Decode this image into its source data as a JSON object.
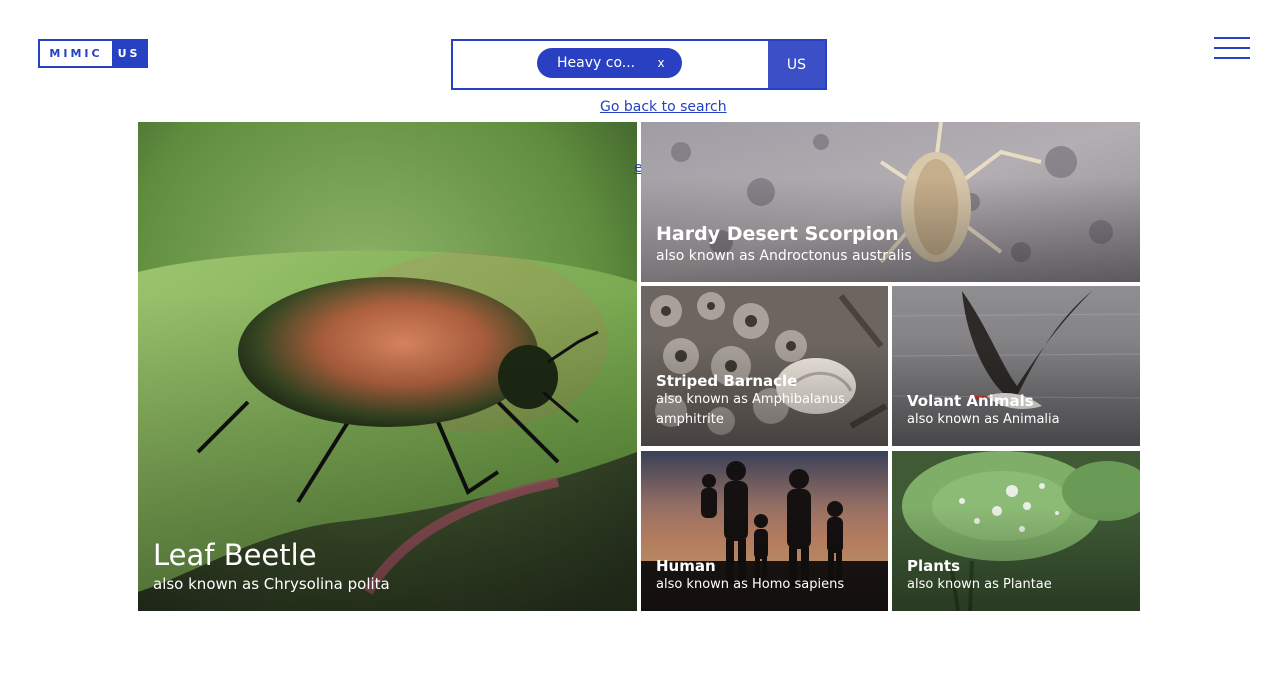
{
  "logo": {
    "left_text": "MIMIC",
    "right_text": "US"
  },
  "search": {
    "chip_label": "Heavy co...",
    "chip_close": "x",
    "submit_label": "US"
  },
  "back_link": "Go back to search",
  "ghost_link": "e",
  "tiles": [
    {
      "title": "Leaf Beetle",
      "subtitle": "also known as Chrysolina polita"
    },
    {
      "title": "Hardy Desert Scorpion",
      "subtitle": "also known as Androctonus australis"
    },
    {
      "title": "Striped Barnacle",
      "subtitle": "also known as Amphibalanus amphitrite"
    },
    {
      "title": "Volant Animals",
      "subtitle": "also known as Animalia"
    },
    {
      "title": "Human",
      "subtitle": "also known as Homo sapiens"
    },
    {
      "title": "Plants",
      "subtitle": "also known as Plantae"
    }
  ],
  "colors": {
    "brand": "#2641c1",
    "chip": "#2a40c3",
    "submit": "#3b4fc6"
  },
  "icons": {
    "menu": "hamburger-menu-icon",
    "close": "close-icon"
  }
}
